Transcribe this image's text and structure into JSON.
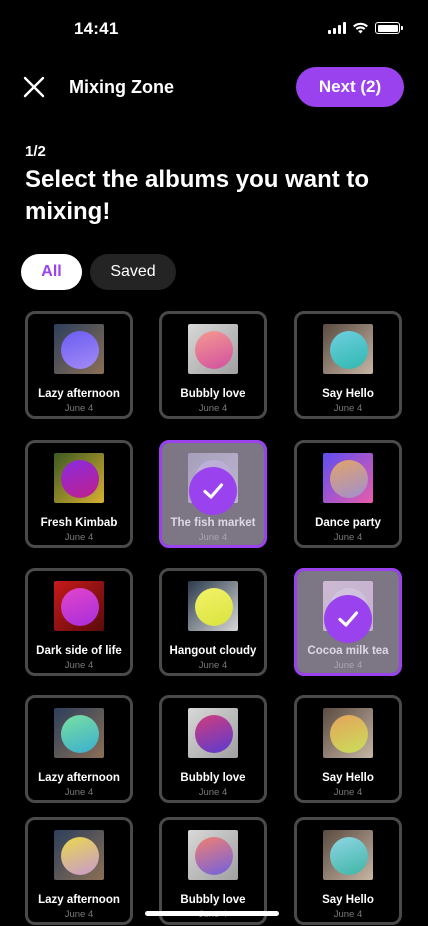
{
  "status": {
    "time": "14:41"
  },
  "header": {
    "title": "Mixing Zone",
    "next_label": "Next (2)"
  },
  "step": "1/2",
  "page_title": "Select the albums you want to mixing!",
  "tabs": [
    {
      "label": "All",
      "active": true
    },
    {
      "label": "Saved",
      "active": false
    }
  ],
  "colors": {
    "accent": "#9a42ee",
    "card_border": "#4a4a4a",
    "background": "#000000"
  },
  "albums": [
    {
      "title": "Lazy afternoon",
      "date": "June 4",
      "selected": false,
      "icon": "album-cover-image",
      "orb": [
        "#6a5cf2",
        "#a38bf5"
      ],
      "bg": [
        "#2c3f5c",
        "#8b6f55"
      ]
    },
    {
      "title": "Bubbly love",
      "date": "June 4",
      "selected": false,
      "icon": "album-cover-image",
      "orb": [
        "#f59a8f",
        "#d14fa1"
      ],
      "bg": [
        "#d8d8d8",
        "#a0a0a0"
      ]
    },
    {
      "title": "Say Hello",
      "date": "June 4",
      "selected": false,
      "icon": "album-cover-image",
      "orb": [
        "#6fcfe0",
        "#2fb8b0"
      ],
      "bg": [
        "#5a4a40",
        "#c7b6a5"
      ]
    },
    {
      "title": "Fresh Kimbab",
      "date": "June 4",
      "selected": false,
      "icon": "album-cover-image",
      "orb": [
        "#8a2be2",
        "#c0208a"
      ],
      "bg": [
        "#3c5a22",
        "#d8b030"
      ]
    },
    {
      "title": "The fish market",
      "date": "June 4",
      "selected": true,
      "icon": "album-cover-image",
      "orb": [
        "#b69ce0",
        "#8c7ac0"
      ],
      "bg": [
        "#6c6d8d",
        "#b0a7c5"
      ]
    },
    {
      "title": "Dance party",
      "date": "June 4",
      "selected": false,
      "icon": "album-cover-image",
      "orb": [
        "#e2a46a",
        "#a08fd0"
      ],
      "bg": [
        "#5e4ef0",
        "#e85cab"
      ]
    },
    {
      "title": "Dark side of life",
      "date": "June 4",
      "selected": false,
      "icon": "album-cover-image",
      "orb": [
        "#e246c9",
        "#a82ddc"
      ],
      "bg": [
        "#c71a1a",
        "#5a0a0a"
      ]
    },
    {
      "title": "Hangout cloudy",
      "date": "June 4",
      "selected": false,
      "icon": "album-cover-image",
      "orb": [
        "#f3f26a",
        "#d9e43c"
      ],
      "bg": [
        "#2c3a4c",
        "#d8d8d8"
      ]
    },
    {
      "title": "Cocoa milk tea",
      "date": "June 4",
      "selected": true,
      "icon": "album-cover-image",
      "orb": [
        "#e6d1ea",
        "#c8b0d8"
      ],
      "bg": [
        "#d4b0cc",
        "#b89ac0"
      ]
    },
    {
      "title": "Lazy afternoon",
      "date": "June 4",
      "selected": false,
      "icon": "album-cover-image",
      "orb": [
        "#7ae0a0",
        "#3aaed0"
      ],
      "bg": [
        "#2c3f5c",
        "#8b6f55"
      ]
    },
    {
      "title": "Bubbly love",
      "date": "June 4",
      "selected": false,
      "icon": "album-cover-image",
      "orb": [
        "#d23c7d",
        "#5a3bd0"
      ],
      "bg": [
        "#d8d8d8",
        "#a0a0a0"
      ]
    },
    {
      "title": "Say Hello",
      "date": "June 4",
      "selected": false,
      "icon": "album-cover-image",
      "orb": [
        "#e6a25c",
        "#c8e05a"
      ],
      "bg": [
        "#5a4a40",
        "#c7b6a5"
      ]
    },
    {
      "title": "Lazy afternoon",
      "date": "June 4",
      "selected": false,
      "icon": "album-cover-image",
      "orb": [
        "#e9d84c",
        "#c89ad0"
      ],
      "bg": [
        "#2c3f5c",
        "#8b6f55"
      ]
    },
    {
      "title": "Bubbly love",
      "date": "June 4",
      "selected": false,
      "icon": "album-cover-image",
      "orb": [
        "#f28070",
        "#6f60e0"
      ],
      "bg": [
        "#d8d8d8",
        "#a0a0a0"
      ]
    },
    {
      "title": "Say Hello",
      "date": "June 4",
      "selected": false,
      "icon": "album-cover-image",
      "orb": [
        "#8fd5e5",
        "#3fb6a5"
      ],
      "bg": [
        "#5a4a40",
        "#c7b6a5"
      ]
    }
  ]
}
